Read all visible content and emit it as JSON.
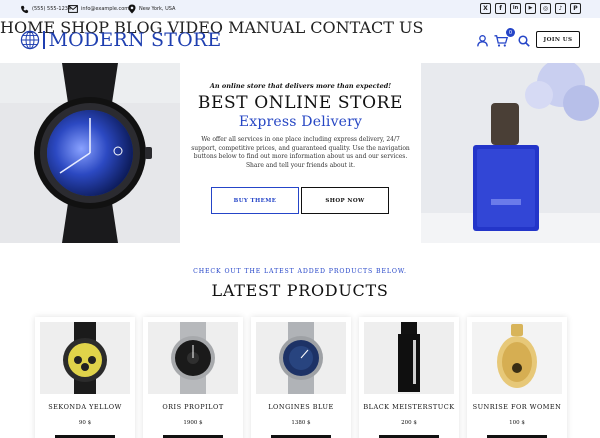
{
  "topbar": {
    "phone": "(555) 555-1234",
    "email": "info@example.com",
    "location": "New York, USA",
    "social": [
      {
        "icon": "x-icon",
        "glyph": "X"
      },
      {
        "icon": "facebook-icon",
        "glyph": "f"
      },
      {
        "icon": "linkedin-icon",
        "glyph": "in"
      },
      {
        "icon": "youtube-icon",
        "glyph": "▶"
      },
      {
        "icon": "instagram-icon",
        "glyph": "◎"
      },
      {
        "icon": "tiktok-icon",
        "glyph": "♪"
      },
      {
        "icon": "pinterest-icon",
        "glyph": "P"
      }
    ]
  },
  "header": {
    "logo_text": "MODERN STORE",
    "nav": [
      "HOME",
      "SHOP",
      "BLOG",
      "VIDEO MANUAL",
      "CONTACT US"
    ],
    "cart_count": "0",
    "join_label": "JOIN US"
  },
  "hero": {
    "tagline": "An online store that delivers more than expected!",
    "title": "BEST ONLINE STORE",
    "subtitle": "Express Delivery",
    "description": "We offer all services in one place including express delivery, 24/7 support, competitive prices, and guaranteed quality. Use the navigation buttons below to find out more information about us and our services. Share and tell your friends about it.",
    "buy_label": "BUY THEME",
    "shop_label": "SHOP NOW"
  },
  "products": {
    "kicker": "CHECK OUT THE LATEST ADDED PRODUCTS BELOW.",
    "heading": "LATEST PRODUCTS",
    "items": [
      {
        "name": "SEKONDA YELLOW",
        "price": "90 $"
      },
      {
        "name": "ORIS PROPILOT",
        "price": "1900 $"
      },
      {
        "name": "LONGINES BLUE",
        "price": "1380 $"
      },
      {
        "name": "BLACK MEISTERSTUCK",
        "price": "200 $"
      },
      {
        "name": "SUNRISE FOR WOMEN",
        "price": "100 $"
      }
    ]
  },
  "colors": {
    "accent": "#2545c8",
    "topbar_bg": "#eef2fb",
    "text": "#111111"
  }
}
